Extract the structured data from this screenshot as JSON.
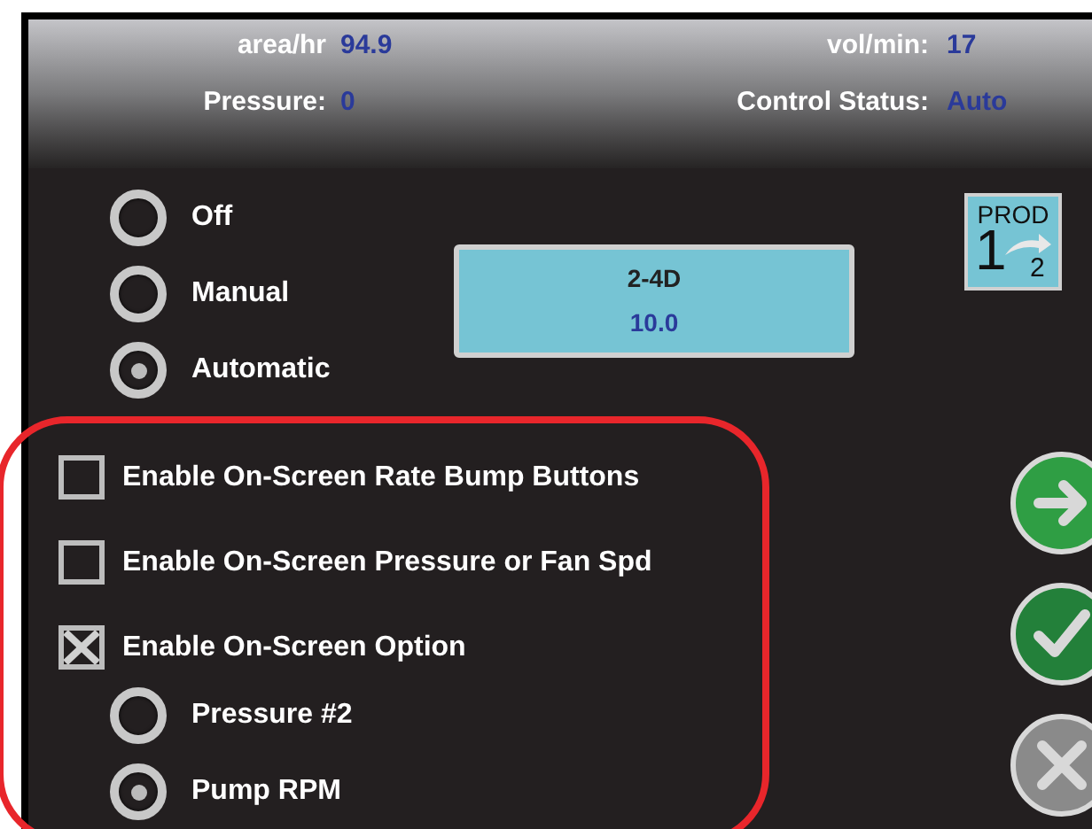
{
  "header": {
    "rows": [
      [
        {
          "label": "area/hr",
          "value": "94.9"
        },
        {
          "label": "vol/min:",
          "value": "17"
        }
      ],
      [
        {
          "label": "Pressure:",
          "value": "0"
        },
        {
          "label": "Control Status:",
          "value": "Auto"
        }
      ]
    ]
  },
  "modes": [
    {
      "label": "Off",
      "selected": false
    },
    {
      "label": "Manual",
      "selected": false
    },
    {
      "label": "Automatic",
      "selected": true
    }
  ],
  "product": {
    "name": "2-4D",
    "rate": "10.0"
  },
  "product_switch": {
    "label": "PROD",
    "from": "1",
    "to": "2"
  },
  "options": [
    {
      "label": "Enable On-Screen Rate Bump Buttons",
      "checked": false
    },
    {
      "label": "Enable On-Screen Pressure or Fan Spd",
      "checked": false
    },
    {
      "label": "Enable On-Screen Option",
      "checked": true,
      "children": [
        {
          "label": "Pressure #2",
          "selected": false
        },
        {
          "label": "Pump RPM",
          "selected": true
        }
      ]
    }
  ],
  "highlight": {
    "shown": true
  },
  "nav_buttons": [
    {
      "kind": "next"
    },
    {
      "kind": "accept"
    },
    {
      "kind": "cancel"
    }
  ]
}
